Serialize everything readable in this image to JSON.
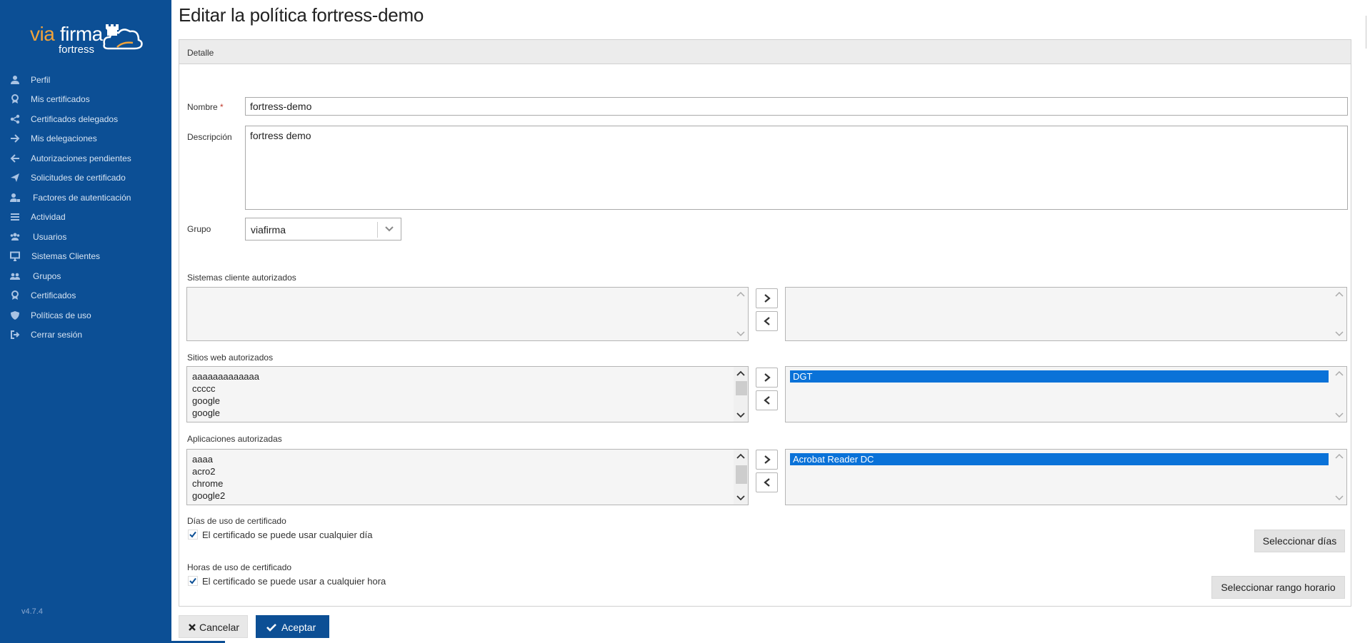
{
  "brand": {
    "logo_via": "via",
    "logo_firma": "firma",
    "logo_fortress": "fortress",
    "version": "v4.7.4",
    "colors": {
      "sidebar": "#0c4f95",
      "accent": "#f2a33a",
      "selection": "#0a72d8"
    }
  },
  "sidebar": {
    "items": [
      {
        "label": "Perfil",
        "icon": "user-icon"
      },
      {
        "label": "Mis certificados",
        "icon": "certificate-icon"
      },
      {
        "label": "Certificados delegados",
        "icon": "share-icon"
      },
      {
        "label": "Mis delegaciones",
        "icon": "arrow-right-icon"
      },
      {
        "label": "Autorizaciones pendientes",
        "icon": "arrow-left-icon"
      },
      {
        "label": "Solicitudes de certificado",
        "icon": "paper-plane-icon"
      },
      {
        "label": "Factores de autenticación",
        "icon": "user-lock-icon"
      },
      {
        "label": "Actividad",
        "icon": "list-icon"
      },
      {
        "label": "Usuarios",
        "icon": "users-icon"
      },
      {
        "label": "Sistemas Clientes",
        "icon": "desktop-icon"
      },
      {
        "label": "Grupos",
        "icon": "group-icon"
      },
      {
        "label": "Certificados",
        "icon": "certificate-icon"
      },
      {
        "label": "Políticas de uso",
        "icon": "shield-icon"
      },
      {
        "label": "Cerrar sesión",
        "icon": "sign-out-icon"
      }
    ]
  },
  "page": {
    "title": "Editar la política fortress-demo",
    "panel_header": "Detalle"
  },
  "form": {
    "nombre_label": "Nombre",
    "required_mark": "*",
    "nombre_value": "fortress-demo",
    "descripcion_label": "Descripción",
    "descripcion_value": "fortress demo",
    "grupo_label": "Grupo",
    "grupo_value": "viafirma"
  },
  "sistemas": {
    "label": "Sistemas cliente autorizados",
    "available": [],
    "selected": []
  },
  "sitios": {
    "label": "Sitios web autorizados",
    "available": [
      "aaaaaaaaaaaaa",
      "ccccc",
      "google",
      "google"
    ],
    "selected": [
      "DGT"
    ]
  },
  "aplicaciones": {
    "label": "Aplicaciones autorizadas",
    "available": [
      "aaaa",
      "acro2",
      "chrome",
      "google2"
    ],
    "selected": [
      "Acrobat Reader DC"
    ]
  },
  "dias": {
    "label": "Días de uso de certificado",
    "check_label": "El certificado se puede usar cualquier día",
    "checked": true,
    "button": "Seleccionar días"
  },
  "horas": {
    "label": "Horas de uso de certificado",
    "check_label": "El certificado se puede usar a cualquier hora",
    "checked": true,
    "button": "Seleccionar rango horario"
  },
  "actions": {
    "cancel": "Cancelar",
    "accept": "Aceptar"
  }
}
